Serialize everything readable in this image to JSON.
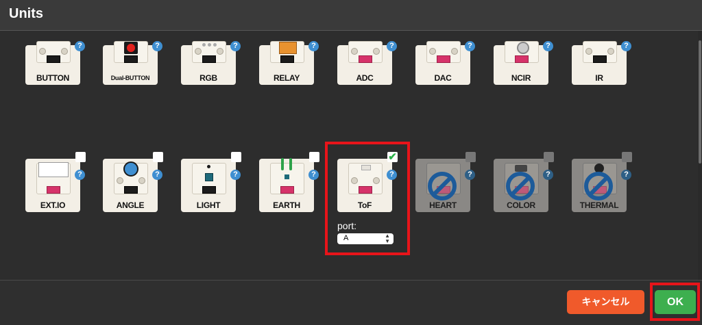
{
  "window": {
    "title": "Units"
  },
  "units_row1": [
    {
      "name": "BUTTON"
    },
    {
      "name": "Dual-BUTTON"
    },
    {
      "name": "RGB"
    },
    {
      "name": "RELAY"
    },
    {
      "name": "ADC"
    },
    {
      "name": "DAC"
    },
    {
      "name": "NCIR"
    },
    {
      "name": "IR"
    }
  ],
  "units_row2": [
    {
      "name": "EXT.IO",
      "checked": false
    },
    {
      "name": "ANGLE",
      "checked": false
    },
    {
      "name": "LIGHT",
      "checked": false
    },
    {
      "name": "EARTH",
      "checked": false
    },
    {
      "name": "ToF",
      "checked": true
    },
    {
      "name": "HEART",
      "checked": false,
      "disabled": true
    },
    {
      "name": "COLOR",
      "checked": false,
      "disabled": true
    },
    {
      "name": "THERMAL",
      "checked": false,
      "disabled": true
    }
  ],
  "help_glyph": "?",
  "check_glyph": "✔",
  "port": {
    "label": "port:",
    "value": "A"
  },
  "footer": {
    "cancel_label": "キャンセル",
    "ok_label": "OK"
  },
  "colors": {
    "accent_green": "#3daf4f",
    "accent_orange": "#f05a2b",
    "highlight_red": "#e8141a",
    "help_blue": "#3f8fd1",
    "connector_pink": "#d6336a"
  }
}
